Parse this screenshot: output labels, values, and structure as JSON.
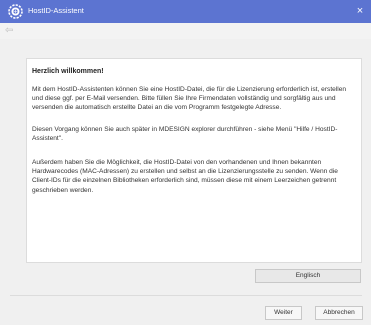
{
  "window": {
    "title": "HostID-Assistent",
    "close_glyph": "×",
    "back_glyph": "⇦"
  },
  "content": {
    "heading": "Herzlich willkommen!",
    "paragraph1": "Mit dem HostID-Assistenten können Sie eine HostID-Datei, die für die Lizenzierung erforderlich ist, erstellen und diese ggf. per E-Mail versenden. Bitte füllen Sie Ihre Firmendaten vollständig und sorgfältig aus und versenden die automatisch erstellte Datei an die vom Programm festgelegte Adresse.",
    "paragraph2": "Diesen Vorgang können Sie auch später in MDESIGN explorer durchführen - siehe Menü \"Hilfe / HostID-Assistent\".",
    "paragraph3": "Außerdem haben Sie die Möglichkeit, die HostID-Datei von den vorhandenen und Ihnen bekannten Hardwarecodes (MAC-Adressen) zu erstellen und selbst an die Lizenzierungsstelle zu senden. Wenn die Client-IDs für die einzelnen Bibliotheken erforderlich sind, müssen diese mit einem Leerzeichen getrennt geschrieben werden."
  },
  "buttons": {
    "language": "Englisch",
    "next": "Weiter",
    "cancel": "Abbrechen"
  },
  "icons": {
    "app_icon": "gear-globe-icon",
    "close_icon": "close-icon",
    "back_icon": "back-arrow-icon"
  },
  "colors": {
    "titlebar": "#5c74d1",
    "background": "#f0f0f0"
  }
}
